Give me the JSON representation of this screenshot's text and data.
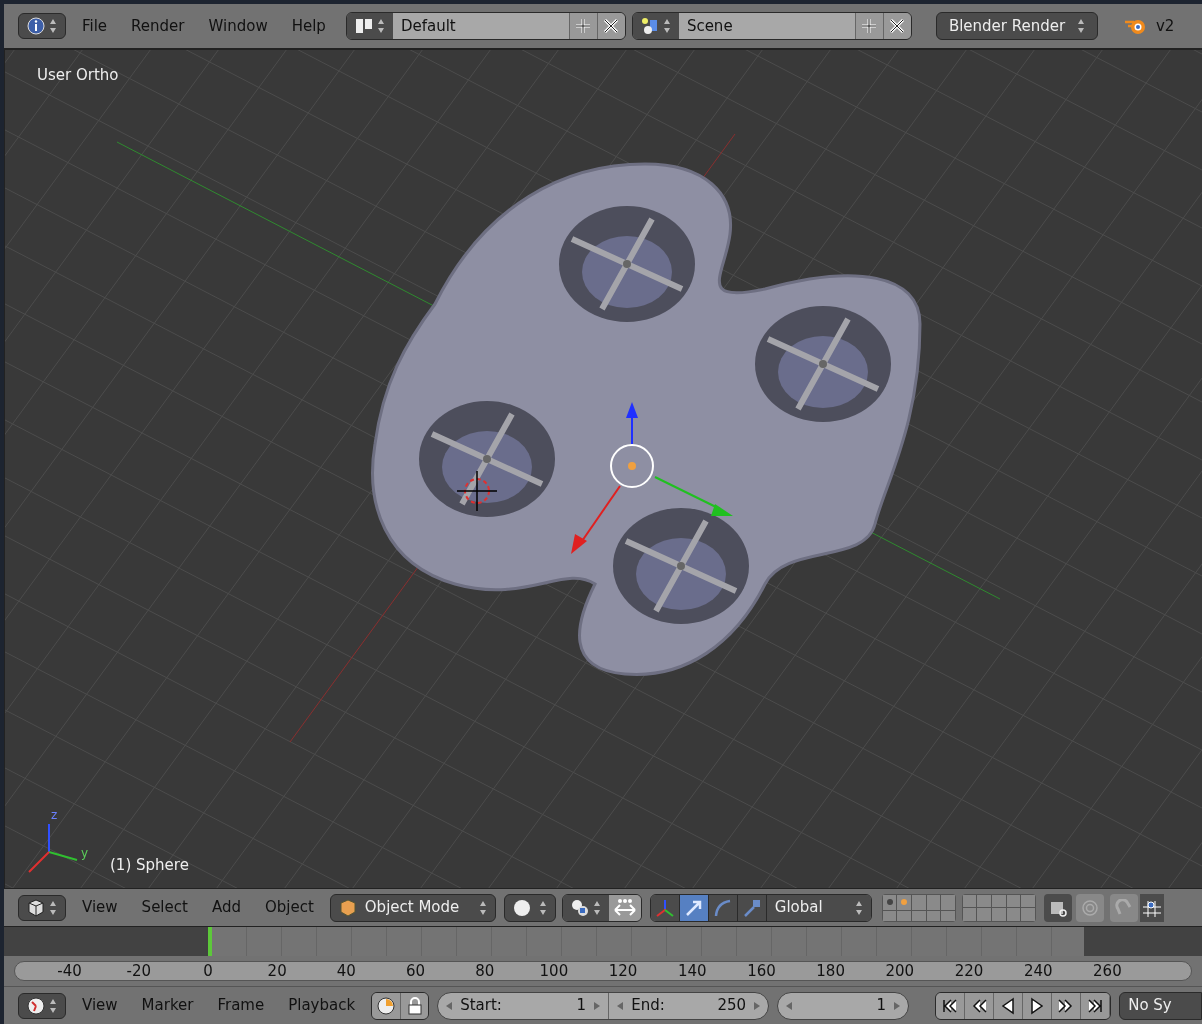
{
  "top_bar": {
    "menus": [
      "File",
      "Render",
      "Window",
      "Help"
    ],
    "layout": "Default",
    "scene": "Scene",
    "engine": "Blender Render",
    "version": "v2"
  },
  "viewport": {
    "view_name": "User Ortho",
    "object_label": "(1) Sphere",
    "axis_labels": [
      "z",
      "y"
    ]
  },
  "view3d_header": {
    "menus": [
      "View",
      "Select",
      "Add",
      "Object"
    ],
    "mode": "Object Mode",
    "orientation": "Global",
    "manipulators": [
      {
        "kind": "axes",
        "selected": false
      },
      {
        "kind": "translate",
        "selected": true
      },
      {
        "kind": "rotate",
        "selected": false
      },
      {
        "kind": "scale",
        "selected": false
      }
    ]
  },
  "timeline": {
    "ruler": [
      "-40",
      "-20",
      "0",
      "20",
      "40",
      "60",
      "80",
      "100",
      "120",
      "140",
      "160",
      "180",
      "200",
      "220",
      "240",
      "260"
    ]
  },
  "timeline_header": {
    "menus": [
      "View",
      "Marker",
      "Frame",
      "Playback"
    ],
    "start": {
      "label": "Start:",
      "value": "1"
    },
    "end": {
      "label": "End:",
      "value": "250"
    },
    "current": "1",
    "sync": "No Sy"
  }
}
